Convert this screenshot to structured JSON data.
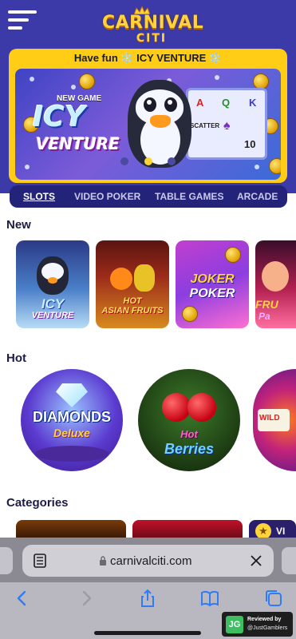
{
  "header": {
    "logo_line1": "CARNIVAL",
    "logo_line2": "CITI"
  },
  "banner": {
    "title": "Have fun ❄️ ICY VENTURE ❄️",
    "tag": "NEW GAME",
    "game_name_1": "ICY",
    "game_name_2": "VENTURE",
    "slot_symbols": [
      "A",
      "Q",
      "K",
      "SCATTER",
      "♠",
      "10"
    ],
    "active_dot_index": 1,
    "dot_count": 3
  },
  "tabs": [
    {
      "label": "SLOTS",
      "active": true
    },
    {
      "label": "VIDEO POKER",
      "active": false
    },
    {
      "label": "TABLE GAMES",
      "active": false
    },
    {
      "label": "ARCADE",
      "active": false
    }
  ],
  "sections": {
    "new_title": "New",
    "hot_title": "Hot",
    "categories_title": "Categories"
  },
  "new_games": [
    {
      "line1": "ICY",
      "line2": "VENTURE"
    },
    {
      "line1": "HOT",
      "line2": "ASIAN FRUITS"
    },
    {
      "line1": "JOKER",
      "line2": "POKER"
    },
    {
      "line1": "FRU",
      "line2": "Pa"
    }
  ],
  "hot_games": [
    {
      "line1": "DIAMONDS",
      "line2": "Deluxe"
    },
    {
      "line1": "Hot",
      "line2": "Berries"
    },
    {
      "line1": "WILD",
      "line2": ""
    }
  ],
  "categories": [
    {
      "label": ""
    },
    {
      "label": ""
    },
    {
      "label": "VI"
    }
  ],
  "browser": {
    "url": "carnivalciti.com"
  },
  "review_badge": {
    "logo": "JG",
    "line1": "Reviewed by",
    "line2": "@JustGamblers"
  },
  "colors": {
    "header_bg": "#3b3aa8",
    "banner_yellow": "#ffcc16",
    "tabs_bg": "#24237a",
    "section_title": "#1c1c45"
  }
}
